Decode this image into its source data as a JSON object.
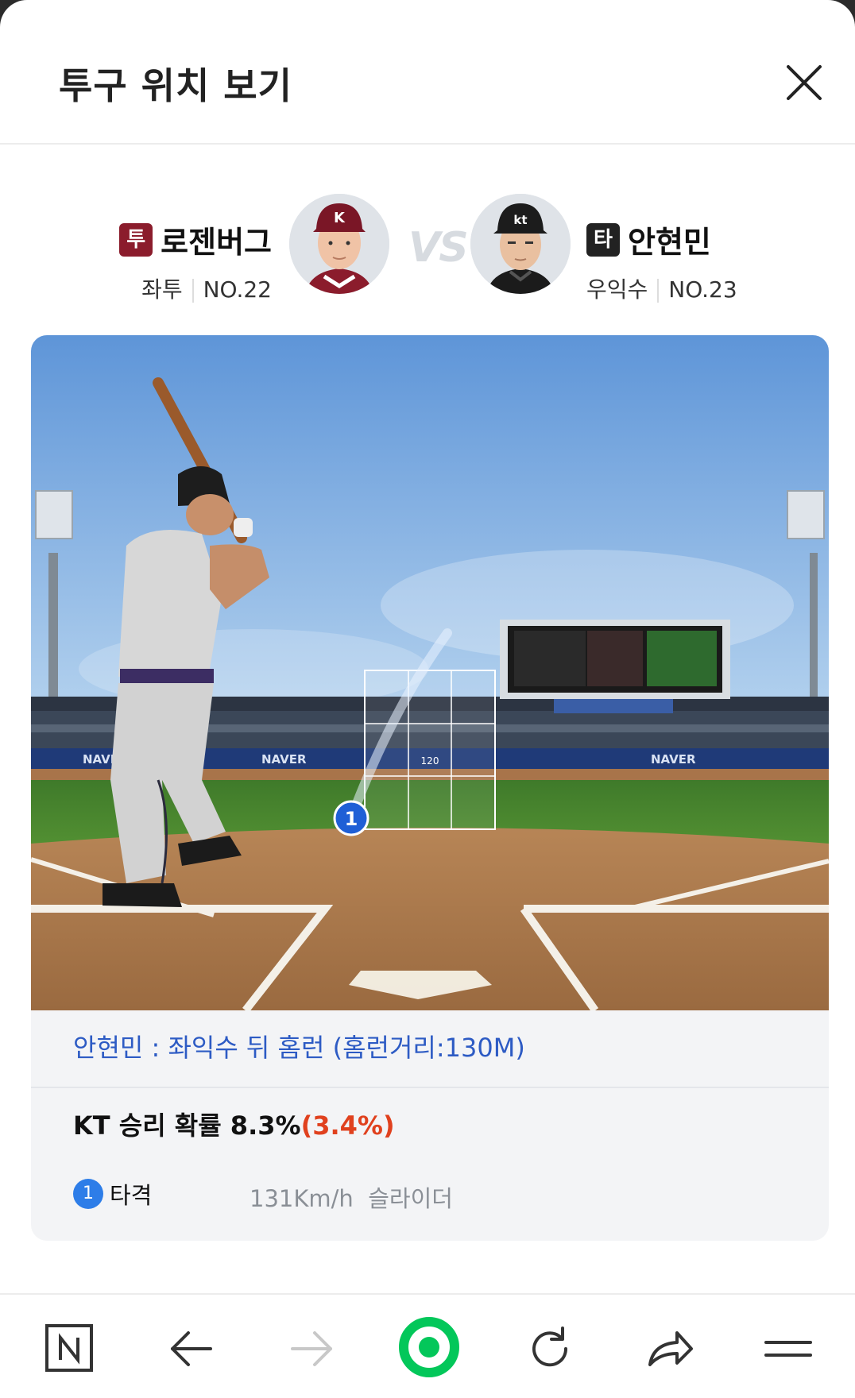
{
  "header": {
    "title": "투구 위치 보기",
    "close_icon": "close-icon"
  },
  "matchup": {
    "pitcher": {
      "badge": "투",
      "badge_color": "#8b1c2c",
      "name": "로젠버그",
      "hand": "좌투",
      "number": "NO.22"
    },
    "vs_label": "VS",
    "batter": {
      "badge": "타",
      "badge_color": "#222222",
      "name": "안현민",
      "hand": "우익수",
      "number": "NO.23"
    }
  },
  "scene": {
    "wall_ads": [
      "NAVER",
      "NAVER",
      "NAVER"
    ],
    "zone_label": "120",
    "pitch_marker": "1"
  },
  "summary": {
    "result_text": "안현민 : 좌익수 뒤 홈런 (홈런거리:130M)",
    "win_prob_label": "KT 승리 확률 8.3%",
    "win_prob_delta": "(3.4%)",
    "pitch": {
      "number": "1",
      "label": "타격",
      "speed": "131Km/h",
      "type": "슬라이더"
    }
  },
  "colors": {
    "link_blue": "#2d5bc4",
    "delta_red": "#e0411e",
    "pitch_blue": "#2d7de8",
    "naver_green": "#03c75a"
  },
  "navbar": [
    "naver-n-icon",
    "back-arrow-icon",
    "forward-arrow-icon",
    "naver-home-icon",
    "refresh-icon",
    "share-icon",
    "menu-icon"
  ]
}
